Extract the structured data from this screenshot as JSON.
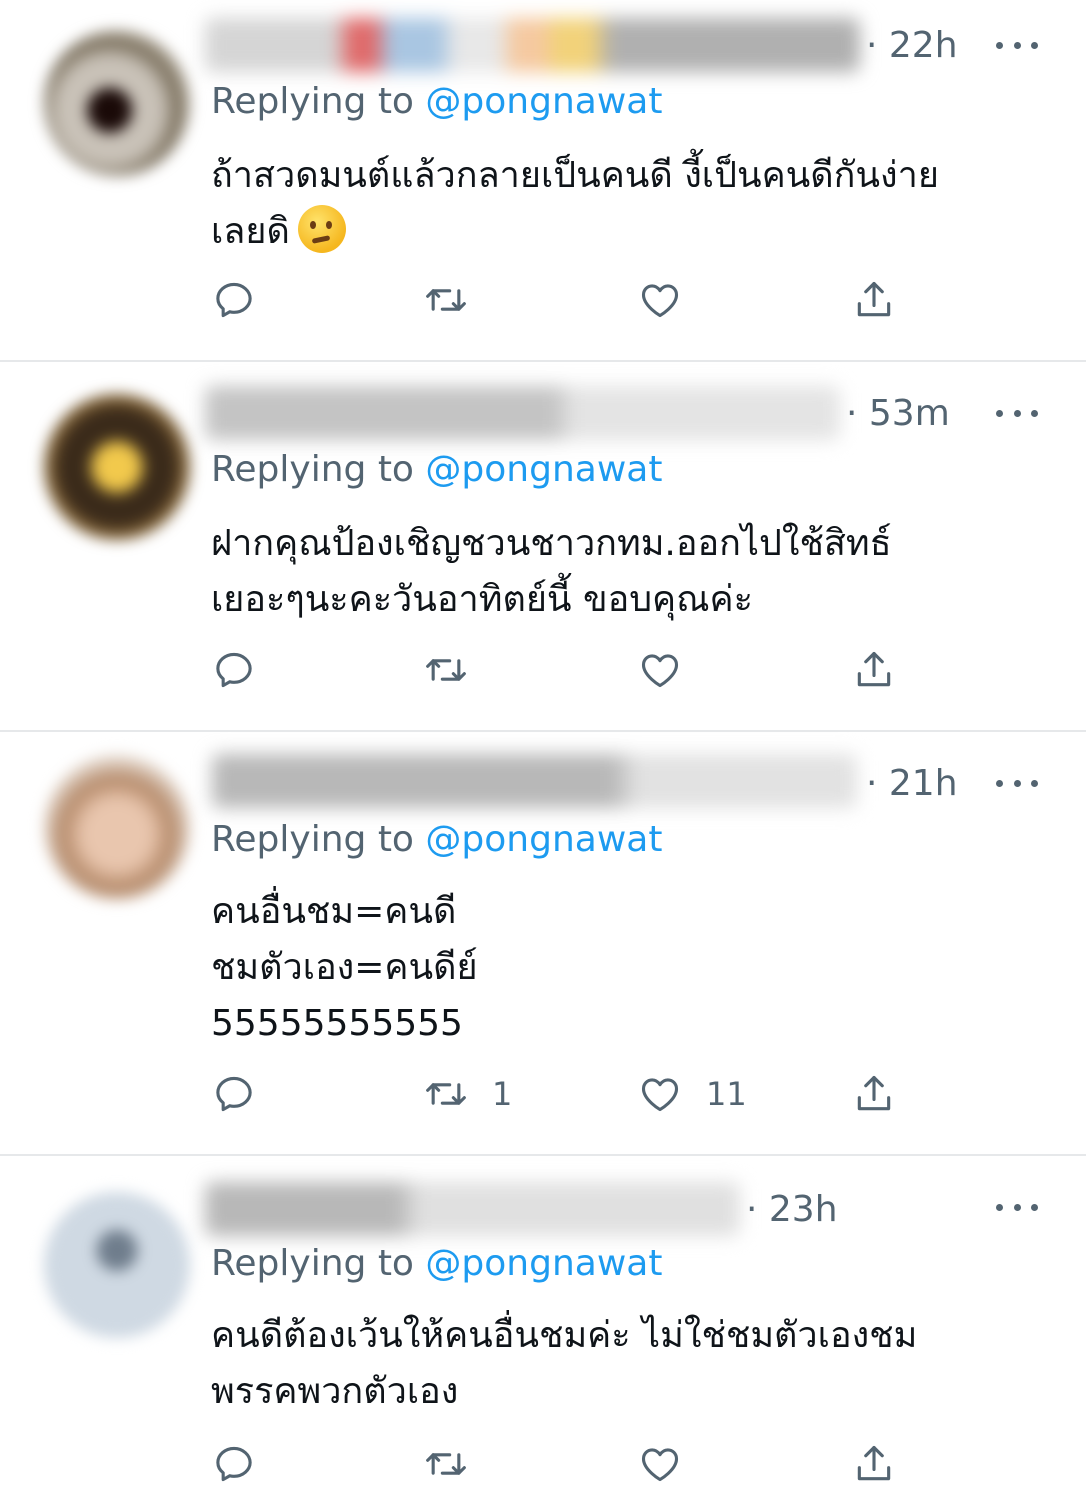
{
  "tweets": [
    {
      "time": "22h",
      "replying_prefix": "Replying to",
      "reply_handle": "@pongnawat",
      "text_lines": [
        "ถ้าสวดมนต์แล้วกลายเป็นคนดี งี้เป็นคนดีกันง่าย",
        "เลยดิ"
      ],
      "emoji": "thinking-face",
      "retweets": "",
      "likes": ""
    },
    {
      "time": "53m",
      "replying_prefix": "Replying to",
      "reply_handle": "@pongnawat",
      "text_lines": [
        "ฝากคุณป้องเชิญชวนชาวกทม.ออกไปใช้สิทธ์",
        "เยอะๆนะคะวันอาทิตย์นี้ ขอบคุณค่ะ"
      ],
      "retweets": "",
      "likes": ""
    },
    {
      "time": "21h",
      "replying_prefix": "Replying to",
      "reply_handle": "@pongnawat",
      "text_lines": [
        "คนอื่นชม=คนดี",
        "ชมตัวเอง=คนดีย์",
        "55555555555"
      ],
      "retweets": "1",
      "likes": "11"
    },
    {
      "time": "23h",
      "replying_prefix": "Replying to",
      "reply_handle": "@pongnawat",
      "text_lines": [
        "คนดีต้องเว้นให้คนอื่นชมค่ะ ไม่ใช่ชมตัวเองชม",
        "พรรคพวกตัวเอง"
      ],
      "retweets": "",
      "likes": ""
    }
  ],
  "icons": [
    "reply-icon",
    "retweet-icon",
    "like-icon",
    "share-icon",
    "more-icon"
  ],
  "colors": {
    "secondary_text": "#536471",
    "link": "#1d9bf0",
    "divider": "#e6e8ea"
  }
}
